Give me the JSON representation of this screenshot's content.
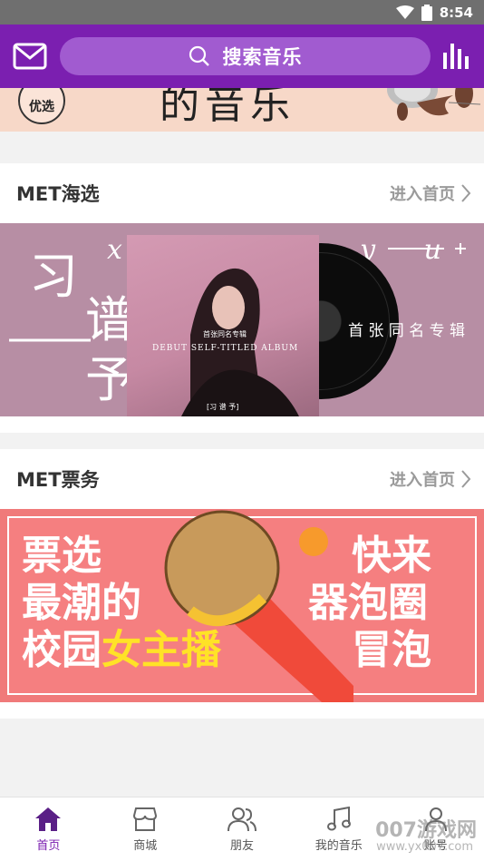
{
  "status_bar": {
    "time": "8:54"
  },
  "header": {
    "search_label": "搜索音乐"
  },
  "top_banner": {
    "badge": "优选",
    "big_text": "的音乐"
  },
  "sections": [
    {
      "title": "MET海选",
      "more": "进入首页"
    },
    {
      "title": "MET票务",
      "more": "进入首页"
    }
  ],
  "album_banner": {
    "char1": "习",
    "char2": "谱",
    "char3": "予",
    "pinyin": "x i p u y u",
    "cover_top": "首张同名专辑",
    "cover_sub": "DEBUT SELF-TITLED ALBUM",
    "cover_name": "[习 谱 予]",
    "right_text": "首 张 同 名 专 辑"
  },
  "ticket_banner": {
    "left_line1": "票选",
    "left_line2": "最潮的",
    "left_line3_a": "校园",
    "left_line3_b": "女主播",
    "right_line1": "快来",
    "right_line2": "器泡圈",
    "right_line3": "冒泡"
  },
  "bottom_nav": [
    {
      "label": "首页",
      "icon": "home-icon",
      "active": true
    },
    {
      "label": "商城",
      "icon": "store-icon",
      "active": false
    },
    {
      "label": "朋友",
      "icon": "friends-icon",
      "active": false
    },
    {
      "label": "我的音乐",
      "icon": "music-note-icon",
      "active": false
    },
    {
      "label": "账号",
      "icon": "user-icon",
      "active": false
    }
  ],
  "watermark": {
    "big": "007游戏网",
    "small": "www.yx007.com"
  },
  "colors": {
    "accent": "#7b1fb0",
    "search_bg": "#a15bd0",
    "ticket_bg": "#f57f80",
    "album_bg": "#b78ea4"
  }
}
